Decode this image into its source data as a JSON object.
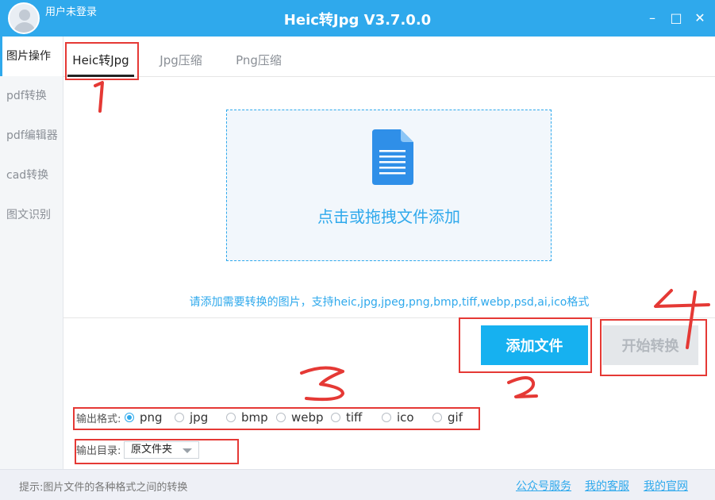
{
  "titlebar": {
    "user_status": "用户未登录",
    "title": "Heic转Jpg V3.7.0.0",
    "minimize_glyph": "–",
    "maximize_glyph": "□",
    "close_glyph": "✕"
  },
  "sidebar": {
    "items": [
      {
        "label": "图片操作"
      },
      {
        "label": "pdf转换"
      },
      {
        "label": "pdf编辑器"
      },
      {
        "label": "cad转换"
      },
      {
        "label": "图文识别"
      }
    ]
  },
  "tabs": [
    {
      "label": "Heic转Jpg"
    },
    {
      "label": "Jpg压缩"
    },
    {
      "label": "Png压缩"
    }
  ],
  "dropzone": {
    "text": "点击或拖拽文件添加",
    "icon": "document-icon"
  },
  "hint": "请添加需要转换的图片，支持heic,jpg,jpeg,png,bmp,tiff,webp,psd,ai,ico格式",
  "buttons": {
    "add_files": "添加文件",
    "start_convert": "开始转换"
  },
  "output_format": {
    "label": "输出格式:",
    "selected": "png",
    "options": [
      "png",
      "jpg",
      "bmp",
      "webp",
      "tiff",
      "ico",
      "gif"
    ]
  },
  "output_dir": {
    "label": "输出目录:",
    "value": "原文件夹"
  },
  "statusbar": {
    "text": "提示:图片文件的各种格式之间的转换",
    "links": [
      "公众号服务",
      "我的客服",
      "我的官网"
    ]
  },
  "annotations": [
    "1",
    "2",
    "3",
    "4"
  ],
  "colors": {
    "accent": "#2fa9ec",
    "add_button": "#16b1f0",
    "annotation": "#e53935"
  }
}
